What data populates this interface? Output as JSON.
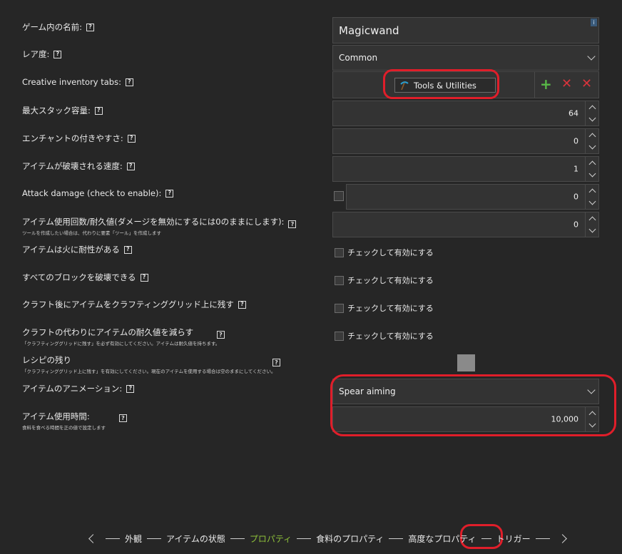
{
  "labels": {
    "name": "ゲーム内の名前:",
    "rarity": "レア度:",
    "creative_tabs": "Creative inventory tabs:",
    "max_stack": "最大スタック容量:",
    "enchantability": "エンチャントの付きやすさ:",
    "destroy_speed": "アイテムが破壊される速度:",
    "attack_damage": "Attack damage (check to enable):",
    "uses": "アイテム使用回数/耐久値(ダメージを無効にするには0のままにします):",
    "uses_sub": "ツールを作成したい場合は、代わりに要素「ツール」を作成します",
    "fire_resistant": "アイテムは火に耐性がある",
    "destroy_any": "すべてのブロックを破壊できる",
    "stay_in_grid": "クラフト後にアイテムをクラフティンググリッド上に残す",
    "damage_on_craft": "クラフトの代わりにアイテムの耐久値を減らす",
    "damage_on_craft_sub": "「クラフティンググリッドに残す」を必ず有効にしてください。アイテムは耐久値を持ちます。",
    "recipe_remainder": "レシピの残り",
    "recipe_remainder_sub": "「クラフティンググリッド上に残す」を有効にしてください。現在のアイテムを使用する場合は空のままにしてください。",
    "animation": "アイテムのアニメーション:",
    "use_duration": "アイテム使用時間:",
    "use_duration_sub": "食料を食べる時間を正の値で設定します",
    "help": "?"
  },
  "fields": {
    "name_value": "Magicwand",
    "info_icon": "i",
    "rarity_value": "Common",
    "creative_tab_chip": "Tools & Utilities",
    "max_stack_value": "64",
    "enchantability_value": "0",
    "destroy_speed_value": "1",
    "attack_damage_value": "0",
    "uses_value": "0",
    "checkbox_text": "チェックして有効にする",
    "animation_value": "Spear aiming",
    "use_duration_value": "10,000"
  },
  "tab_actions": {
    "add": "+",
    "remove": "✕",
    "clear": "✕"
  },
  "nav": {
    "items": [
      "外観",
      "アイテムの状態",
      "プロパティ",
      "食料のプロパティ",
      "高度なプロパティ",
      "トリガー"
    ],
    "active_index": 2
  },
  "colors": {
    "background": "#262626",
    "field": "#333333",
    "accent_green": "#8fc23a",
    "add_green": "#58b947",
    "remove_red": "#d8343c",
    "highlight_red": "#e01e2a"
  }
}
